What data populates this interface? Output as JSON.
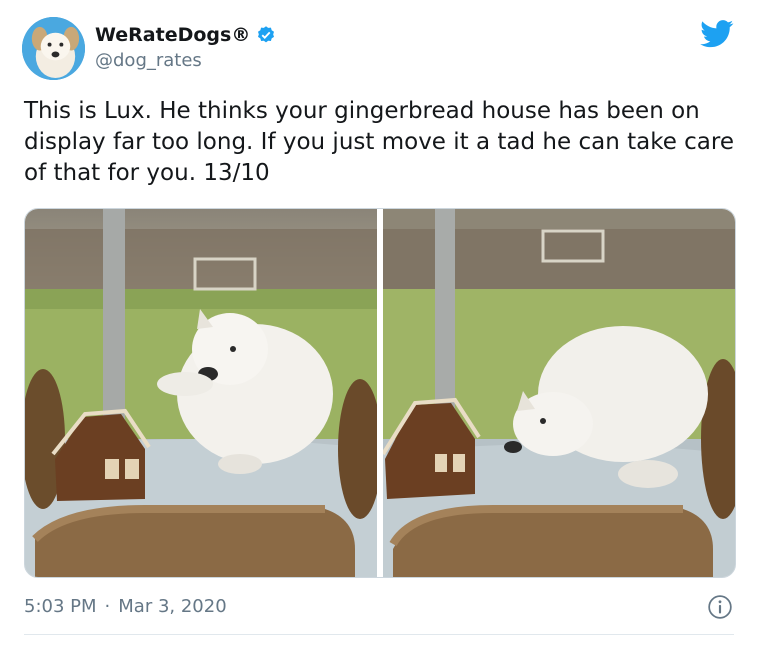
{
  "author": {
    "display_name": "WeRateDogs®",
    "handle": "@dog_rates",
    "verified": true,
    "avatar_icon": "dog-avatar"
  },
  "tweet": {
    "text": "This is Lux. He thinks your gingerbread house has been on display far too long. If you just move it a tad he can take care of that for you. 13/10",
    "time": "5:03 PM",
    "separator": "·",
    "date": "Mar 3, 2020"
  },
  "media": [
    {
      "subject": "white fluffy dog pawing at gingerbread house on table"
    },
    {
      "subject": "white fluffy dog sniffing gingerbread house on table"
    }
  ],
  "colors": {
    "twitter_blue": "#1da1f2",
    "text": "#14171a",
    "secondary": "#657786",
    "border": "#e1e8ed"
  },
  "icons": {
    "brand": "twitter-bird-icon",
    "verified": "verified-badge-icon",
    "info": "info-icon"
  }
}
